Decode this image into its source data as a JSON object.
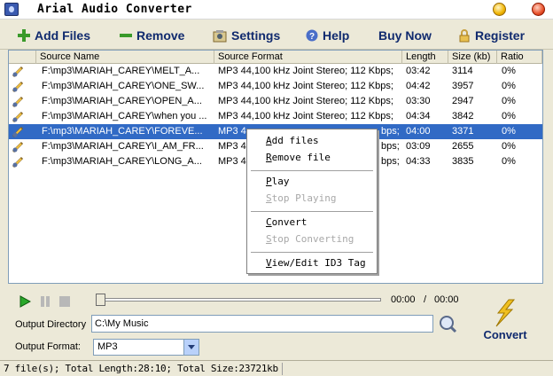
{
  "window": {
    "title": "Arial Audio Converter"
  },
  "toolbar": {
    "add_files": "Add Files",
    "remove": "Remove",
    "settings": "Settings",
    "help": "Help",
    "buy_now": "Buy Now",
    "register": "Register"
  },
  "table": {
    "headers": {
      "source_name": "Source Name",
      "source_format": "Source Format",
      "length": "Length",
      "size": "Size (kb)",
      "ratio": "Ratio"
    },
    "rows": [
      {
        "name": "F:\\mp3\\MARIAH_CAREY\\MELT_A...",
        "format": "MP3  44,100 kHz Joint Stereo;  112 Kbps;",
        "length": "03:42",
        "size": "3114",
        "ratio": "0%"
      },
      {
        "name": "F:\\mp3\\MARIAH_CAREY\\ONE_SW...",
        "format": "MP3  44,100 kHz Joint Stereo;  112 Kbps;",
        "length": "04:42",
        "size": "3957",
        "ratio": "0%"
      },
      {
        "name": "F:\\mp3\\MARIAH_CAREY\\OPEN_A...",
        "format": "MP3  44,100 kHz Joint Stereo;  112 Kbps;",
        "length": "03:30",
        "size": "2947",
        "ratio": "0%"
      },
      {
        "name": "F:\\mp3\\MARIAH_CAREY\\when you ...",
        "format": "MP3  44,100 kHz Joint Stereo;  112 Kbps;",
        "length": "04:34",
        "size": "3842",
        "ratio": "0%"
      },
      {
        "name": "F:\\mp3\\MARIAH_CAREY\\FOREVE...",
        "format": "MP3  4",
        "format_tail": "bps;",
        "length": "04:00",
        "size": "3371",
        "ratio": "0%",
        "selected": true
      },
      {
        "name": "F:\\mp3\\MARIAH_CAREY\\I_AM_FR...",
        "format": "MP3  4",
        "format_tail": "bps;",
        "length": "03:09",
        "size": "2655",
        "ratio": "0%"
      },
      {
        "name": "F:\\mp3\\MARIAH_CAREY\\LONG_A...",
        "format": "MP3  4",
        "format_tail": "bps;",
        "length": "04:33",
        "size": "3835",
        "ratio": "0%"
      }
    ]
  },
  "context_menu": {
    "add_files": "Add files",
    "remove_file": "Remove file",
    "play": "Play",
    "stop_playing": "Stop Playing",
    "convert": "Convert",
    "stop_converting": "Stop Converting",
    "view_edit_id3": "View/Edit ID3 Tag"
  },
  "player": {
    "current_time": "00:00",
    "separator": "/",
    "total_time": "00:00"
  },
  "output": {
    "directory_label": "Output Directory",
    "directory_value": "C:\\My Music",
    "format_label": "Output Format:",
    "format_value": "MP3"
  },
  "convert_button": {
    "label": "Convert"
  },
  "status": {
    "text": "7 file(s); Total Length:28:10; Total Size:23721kb"
  },
  "colors": {
    "selection": "#316ac5",
    "toolbar_text": "#102a6e",
    "window_bg": "#ece9d8"
  }
}
